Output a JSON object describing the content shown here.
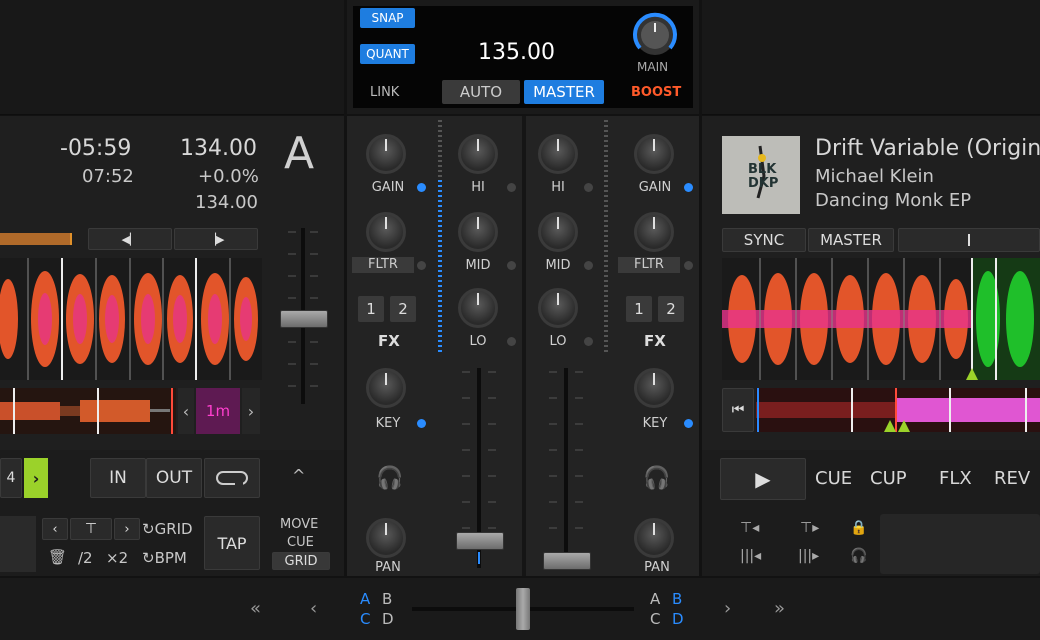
{
  "colors": {
    "accent_blue": "#1e7de0",
    "boost_orange": "#ff5a2a",
    "cue_pink": "#b0209a",
    "green_wave": "#1fbf2a"
  },
  "top_center": {
    "snap": "SNAP",
    "quant": "QUANT",
    "link": "LINK",
    "tempo": "135.00",
    "auto": "AUTO",
    "master": "MASTER",
    "main": "MAIN",
    "boost": "BOOST"
  },
  "deck_a": {
    "letter": "A",
    "time_remaining": "-05:59",
    "time_total": "07:52",
    "bpm": "134.00",
    "pitch": "+0.0%",
    "bpm_original": "134.00",
    "loop_size": "1m",
    "in": "IN",
    "out": "OUT",
    "grid": "GRID",
    "bpm_btn": "BPM",
    "half": "/2",
    "double": "×2",
    "tap": "TAP",
    "move": "MOVE",
    "cue": "CUE",
    "grid_sel": "GRID"
  },
  "mixer": {
    "gain": "GAIN",
    "hi": "HI",
    "mid": "MID",
    "lo": "LO",
    "fltr": "FLTR",
    "fx": "FX",
    "fx1": "1",
    "fx2": "2",
    "key": "KEY",
    "pan": "PAN"
  },
  "deck_b": {
    "title": "Drift Variable (Original Mix)",
    "artist": "Michael Klein",
    "album": "Dancing Monk EP",
    "art_text_1": "BLK",
    "art_text_2": "DKP",
    "sync": "SYNC",
    "master": "MASTER",
    "cue": "CUE",
    "cup": "CUP",
    "flx": "FLX",
    "rev": "REV"
  },
  "bottom": {
    "a": "A",
    "b": "B",
    "c": "C",
    "d": "D"
  }
}
